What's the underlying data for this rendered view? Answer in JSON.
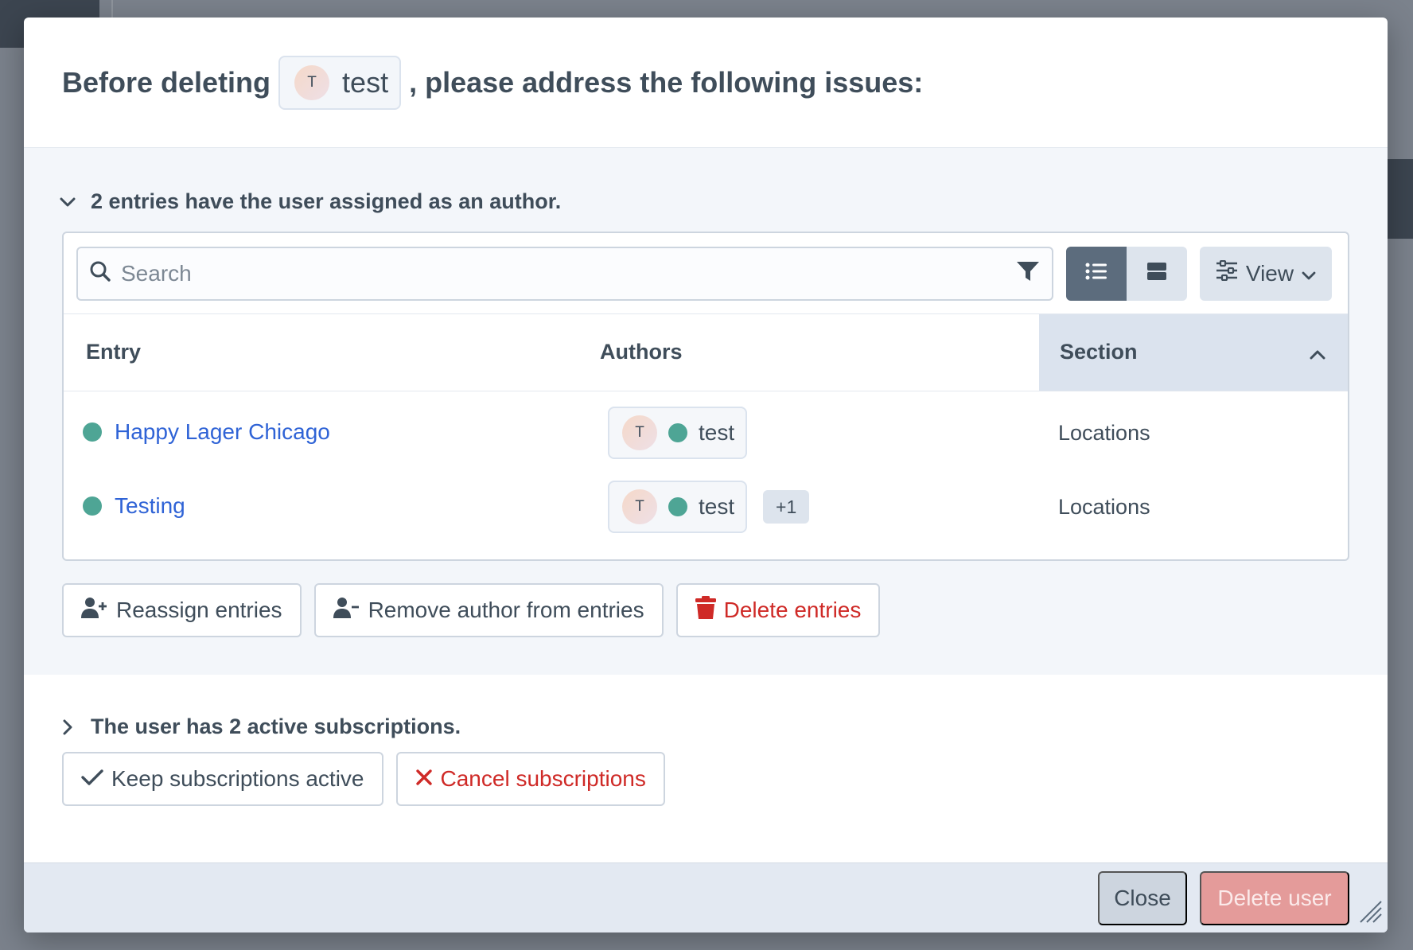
{
  "modal": {
    "title_before": "Before deleting",
    "user_chip": {
      "avatar_initial": "T",
      "name": "test"
    },
    "title_after": ", please address the following issues:"
  },
  "issue_entries": {
    "title": "2 entries have the user assigned as an author.",
    "expanded": true,
    "search": {
      "placeholder": "Search",
      "value": ""
    },
    "view_button_label": "View",
    "table": {
      "headers": [
        "Entry",
        "Authors",
        "Section"
      ],
      "sort_column": "Section",
      "sort_direction": "ascending",
      "rows": [
        {
          "entry": "Happy Lager Chicago",
          "status_color": "#4ea595",
          "author_initial": "T",
          "author_name": "test",
          "extra_authors": "",
          "section": "Locations"
        },
        {
          "entry": "Testing",
          "status_color": "#4ea595",
          "author_initial": "T",
          "author_name": "test",
          "extra_authors": "+1",
          "section": "Locations"
        }
      ]
    },
    "actions": {
      "reassign": "Reassign entries",
      "remove_author": "Remove author from entries",
      "delete": "Delete entries"
    }
  },
  "issue_subscriptions": {
    "title": "The user has 2 active subscriptions.",
    "expanded": false,
    "actions": {
      "keep": "Keep subscriptions active",
      "cancel": "Cancel subscriptions"
    }
  },
  "footer": {
    "close_label": "Close",
    "delete_label": "Delete user"
  },
  "colors": {
    "link": "#2f63d6",
    "danger": "#cf2a27",
    "status_live": "#4ea595",
    "delete_disabled": "#e49b9a"
  }
}
